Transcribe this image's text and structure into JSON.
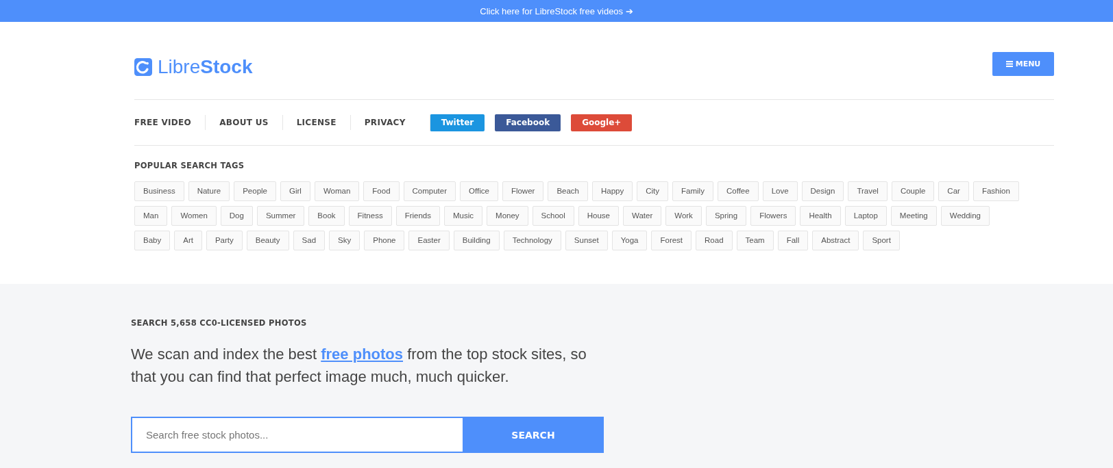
{
  "promo_bar": {
    "text": "Click here for LibreStock free videos",
    "arrow": "➔"
  },
  "logo": {
    "light": "Libre",
    "bold": "Stock"
  },
  "menu_button": {
    "label": "MENU"
  },
  "nav": [
    {
      "label": "FREE VIDEO",
      "kind": "link"
    },
    {
      "label": "ABOUT US",
      "kind": "link"
    },
    {
      "label": "LICENSE",
      "kind": "link"
    },
    {
      "label": "PRIVACY",
      "kind": "link"
    },
    {
      "label": "Twitter",
      "kind": "social",
      "color": "#1b95e0"
    },
    {
      "label": "Facebook",
      "kind": "social",
      "color": "#3b5998"
    },
    {
      "label": "Google+",
      "kind": "social",
      "color": "#dd4b39"
    }
  ],
  "tags_heading": "POPULAR SEARCH TAGS",
  "tag_rows": [
    [
      "Business",
      "Nature",
      "People",
      "Girl",
      "Woman",
      "Food",
      "Computer",
      "Office",
      "Flower",
      "Beach",
      "Happy",
      "City",
      "Family",
      "Coffee",
      "Love",
      "Design",
      "Travel",
      "Couple",
      "Car",
      "Fashion"
    ],
    [
      "Man",
      "Women",
      "Dog",
      "Summer",
      "Book",
      "Fitness",
      "Friends",
      "Music",
      "Money",
      "School",
      "House",
      "Water",
      "Work",
      "Spring",
      "Flowers",
      "Health",
      "Laptop",
      "Meeting",
      "Wedding"
    ],
    [
      "Baby",
      "Art",
      "Party",
      "Beauty",
      "Sad",
      "Sky",
      "Phone",
      "Easter",
      "Building",
      "Technology",
      "Sunset",
      "Yoga",
      "Forest",
      "Road",
      "Team",
      "Fall",
      "Abstract",
      "Sport"
    ]
  ],
  "search_section": {
    "heading": "SEARCH 5,658 CC0-LICENSED PHOTOS",
    "intro_before": "We scan and index the best ",
    "intro_link": "free photos",
    "intro_after": " from the top stock sites, so that you can find that perfect image much, much quicker.",
    "placeholder": "Search free stock photos...",
    "button": "SEARCH"
  }
}
